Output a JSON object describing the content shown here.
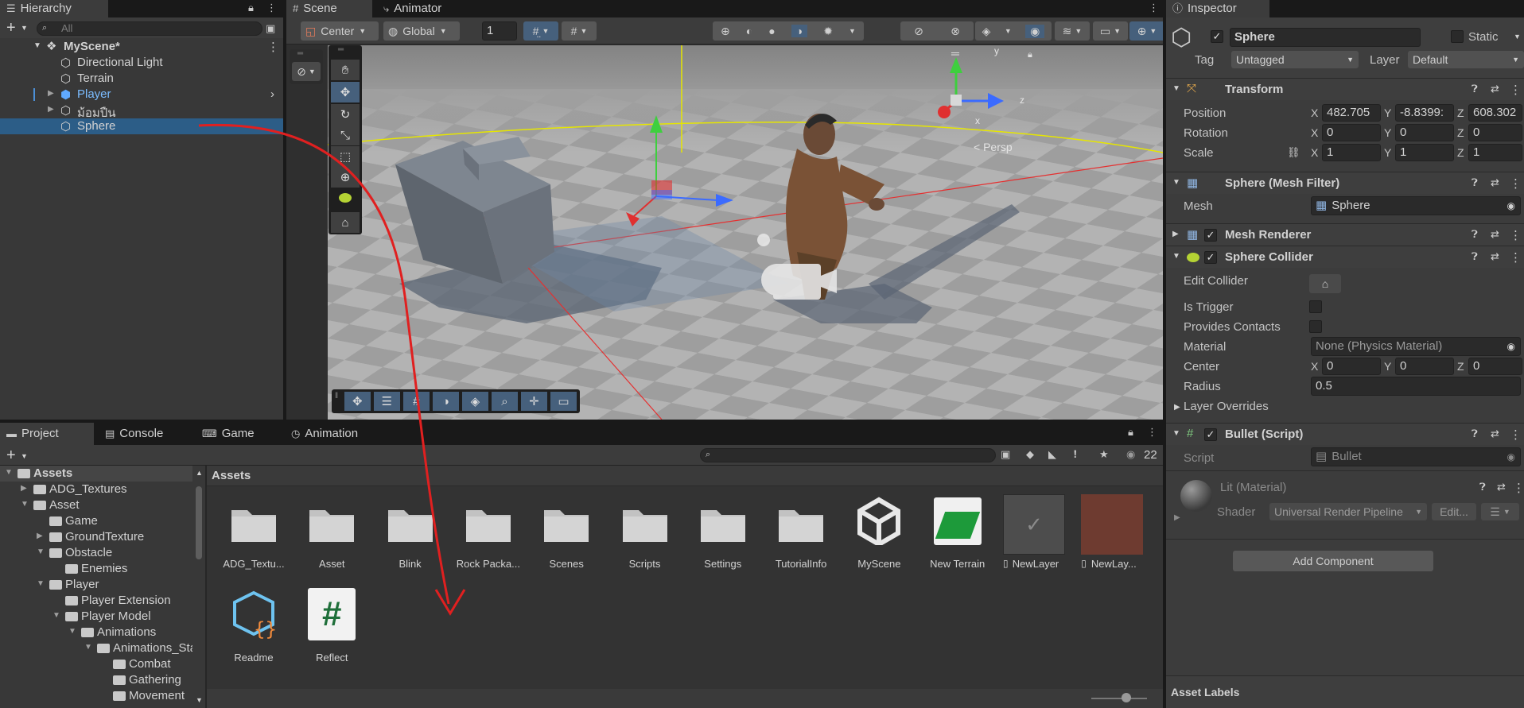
{
  "colors": {
    "accent": "#2c5d87",
    "selected": "#2c5d87",
    "link_blue": "#7bbcff",
    "arrow_red": "#e02020"
  },
  "hierarchy": {
    "tab": "Hierarchy",
    "search_placeholder": "All",
    "scene": "MyScene*",
    "items": [
      {
        "label": "Directional Light",
        "icon": "gameobject-icon"
      },
      {
        "label": "Terrain",
        "icon": "gameobject-icon"
      },
      {
        "label": "Player",
        "icon": "prefab-icon"
      },
      {
        "label": "ม้อมปืน",
        "icon": "gameobject-icon"
      },
      {
        "label": "Sphere",
        "icon": "gameobject-icon"
      }
    ]
  },
  "scene_view": {
    "tabs": [
      "Scene",
      "Animator"
    ],
    "pivot": "Center",
    "space": "Global",
    "grid_size": "1",
    "gizmo_label": "< Persp",
    "axes": [
      "y",
      "z",
      "x"
    ]
  },
  "inspector": {
    "tab": "Inspector",
    "object_name": "Sphere",
    "static_label": "Static",
    "tag_label": "Tag",
    "tag_value": "Untagged",
    "layer_label": "Layer",
    "layer_value": "Default",
    "transform": {
      "title": "Transform",
      "position_label": "Position",
      "position": {
        "x": "482.705",
        "y": "-8.8399:",
        "z": "608.302"
      },
      "rotation_label": "Rotation",
      "rotation": {
        "x": "0",
        "y": "0",
        "z": "0"
      },
      "scale_label": "Scale",
      "scale": {
        "x": "1",
        "y": "1",
        "z": "1"
      }
    },
    "mesh_filter": {
      "title": "Sphere (Mesh Filter)",
      "mesh_label": "Mesh",
      "mesh_value": "Sphere"
    },
    "mesh_renderer": {
      "title": "Mesh Renderer"
    },
    "sphere_collider": {
      "title": "Sphere Collider",
      "edit_collider": "Edit Collider",
      "is_trigger": "Is Trigger",
      "provides_contacts": "Provides Contacts",
      "material_label": "Material",
      "material_value": "None (Physics Material)",
      "center_label": "Center",
      "center": {
        "x": "0",
        "y": "0",
        "z": "0"
      },
      "radius_label": "Radius",
      "radius": "0.5",
      "layer_overrides": "Layer Overrides"
    },
    "bullet_script": {
      "title": "Bullet (Script)",
      "script_label": "Script",
      "script_value": "Bullet"
    },
    "material": {
      "title": "Lit (Material)",
      "shader_label": "Shader",
      "shader_value": "Universal Render Pipeline",
      "edit_label": "Edit..."
    },
    "add_component": "Add Component",
    "asset_labels": "Asset Labels",
    "axis_x": "X",
    "axis_y": "Y",
    "axis_z": "Z"
  },
  "project": {
    "tabs": [
      "Project",
      "Console",
      "Game",
      "Animation"
    ],
    "visible_count": "22",
    "breadcrumb": "Assets",
    "tree": [
      {
        "label": "Assets",
        "depth": 0,
        "open": true,
        "bold": true
      },
      {
        "label": "ADG_Textures",
        "depth": 1,
        "open": false
      },
      {
        "label": "Asset",
        "depth": 1,
        "open": true
      },
      {
        "label": "Game",
        "depth": 2,
        "leaf": true
      },
      {
        "label": "GroundTexture",
        "depth": 2,
        "open": false
      },
      {
        "label": "Obstacle",
        "depth": 2,
        "open": true
      },
      {
        "label": "Enemies",
        "depth": 3,
        "leaf": true
      },
      {
        "label": "Player",
        "depth": 2,
        "open": true
      },
      {
        "label": "Player Extension",
        "depth": 3,
        "leaf": true
      },
      {
        "label": "Player Model",
        "depth": 3,
        "open": true
      },
      {
        "label": "Animations",
        "depth": 4,
        "open": true
      },
      {
        "label": "Animations_Sta",
        "depth": 5,
        "open": true
      },
      {
        "label": "Combat",
        "depth": 6,
        "leaf": true
      },
      {
        "label": "Gathering",
        "depth": 6,
        "leaf": true
      },
      {
        "label": "Movement",
        "depth": 6,
        "leaf": true
      }
    ],
    "assets": [
      {
        "label": "ADG_Textu...",
        "kind": "folder"
      },
      {
        "label": "Asset",
        "kind": "folder"
      },
      {
        "label": "Blink",
        "kind": "folder"
      },
      {
        "label": "Rock Packa...",
        "kind": "folder"
      },
      {
        "label": "Scenes",
        "kind": "folder"
      },
      {
        "label": "Scripts",
        "kind": "folder"
      },
      {
        "label": "Settings",
        "kind": "folder"
      },
      {
        "label": "TutorialInfo",
        "kind": "folder"
      },
      {
        "label": "MyScene",
        "kind": "scene"
      },
      {
        "label": "New Terrain",
        "kind": "terrain"
      },
      {
        "label": "NewLayer",
        "kind": "layer"
      },
      {
        "label": "NewLay...",
        "kind": "layer-texture"
      },
      {
        "label": "Readme",
        "kind": "readme"
      },
      {
        "label": "Reflect",
        "kind": "script"
      }
    ]
  }
}
